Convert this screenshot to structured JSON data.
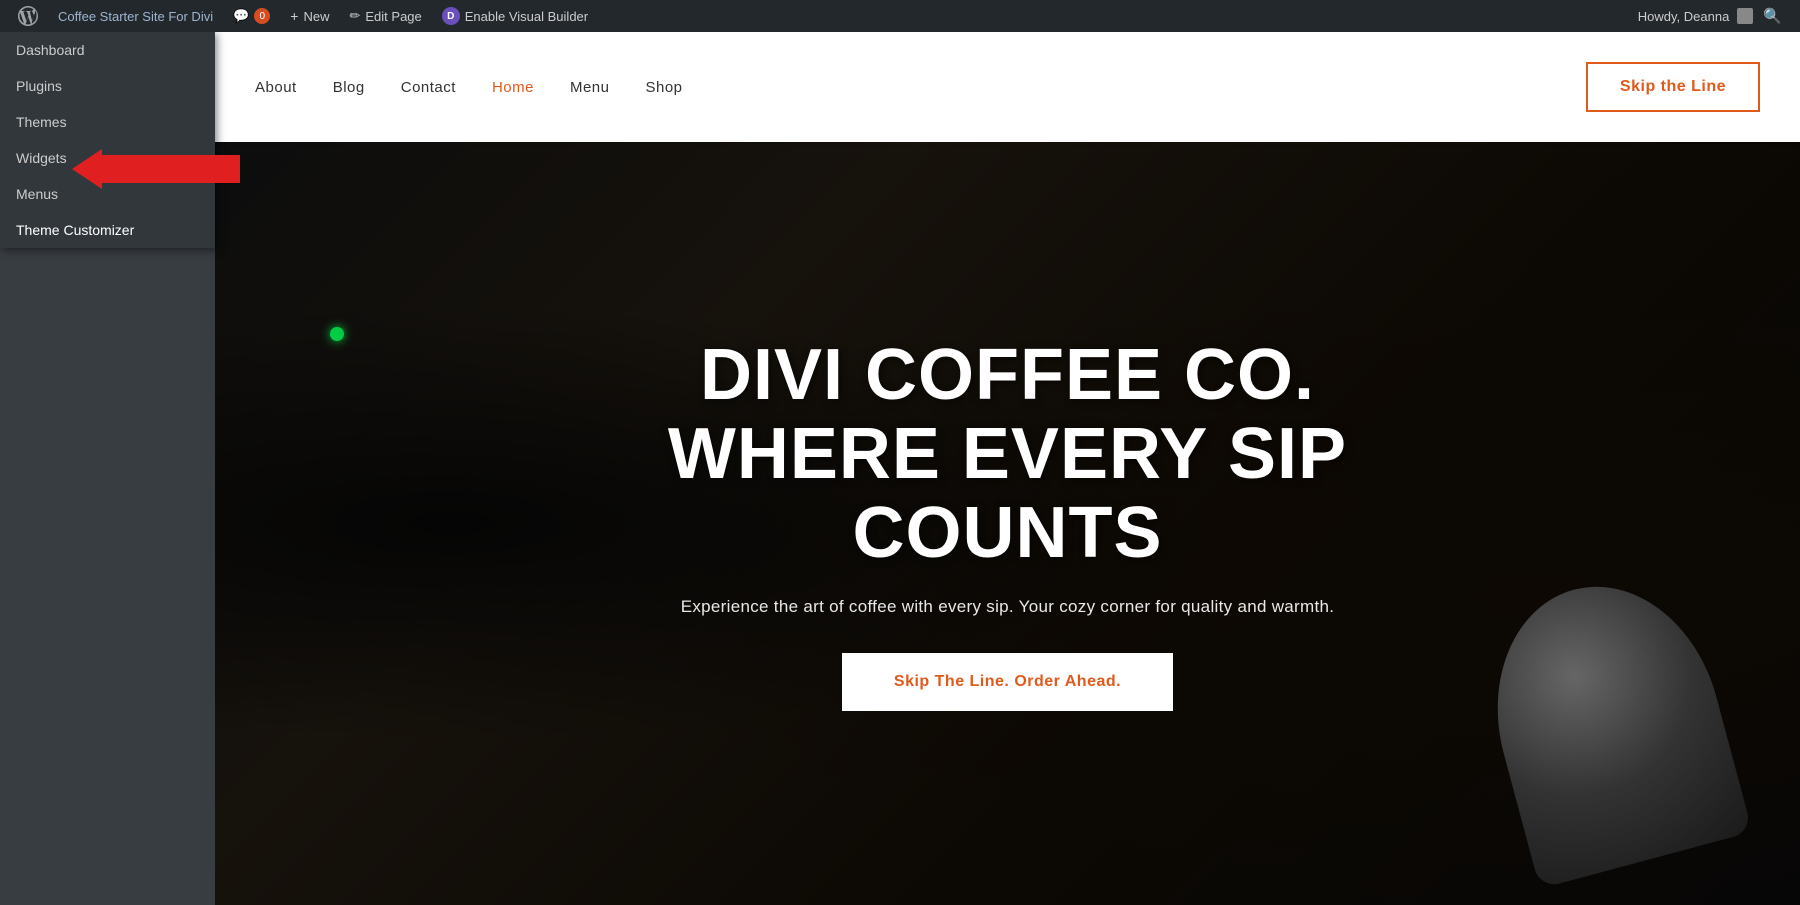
{
  "adminBar": {
    "siteName": "Coffee Starter Site For Divi",
    "commentsCount": "0",
    "newLabel": "New",
    "editPageLabel": "Edit Page",
    "enableVisualBuilder": "Enable Visual Builder",
    "howdy": "Howdy, Deanna",
    "wpLogoAlt": "WordPress"
  },
  "dropdown": {
    "items": [
      {
        "id": "dashboard",
        "label": "Dashboard"
      },
      {
        "id": "plugins",
        "label": "Plugins"
      },
      {
        "id": "themes",
        "label": "Themes"
      },
      {
        "id": "widgets",
        "label": "Widgets"
      },
      {
        "id": "menus",
        "label": "Menus"
      },
      {
        "id": "theme-customizer",
        "label": "Theme Customizer"
      }
    ]
  },
  "nav": {
    "links": [
      {
        "id": "about",
        "label": "About",
        "active": false
      },
      {
        "id": "blog",
        "label": "Blog",
        "active": false
      },
      {
        "id": "contact",
        "label": "Contact",
        "active": false
      },
      {
        "id": "home",
        "label": "Home",
        "active": true
      },
      {
        "id": "menu",
        "label": "Menu",
        "active": false
      },
      {
        "id": "shop",
        "label": "Shop",
        "active": false
      }
    ],
    "ctaButton": "Skip the Line"
  },
  "hero": {
    "title": "DIVI COFFEE CO. WHERE EVERY SIP COUNTS",
    "subtitle": "Experience the art of coffee with every sip. Your cozy corner for quality and warmth.",
    "ctaButton": "Skip The Line. Order Ahead."
  },
  "colors": {
    "accent": "#e05a1c",
    "adminBarBg": "#23282d",
    "dropdownBg": "#32373c"
  }
}
